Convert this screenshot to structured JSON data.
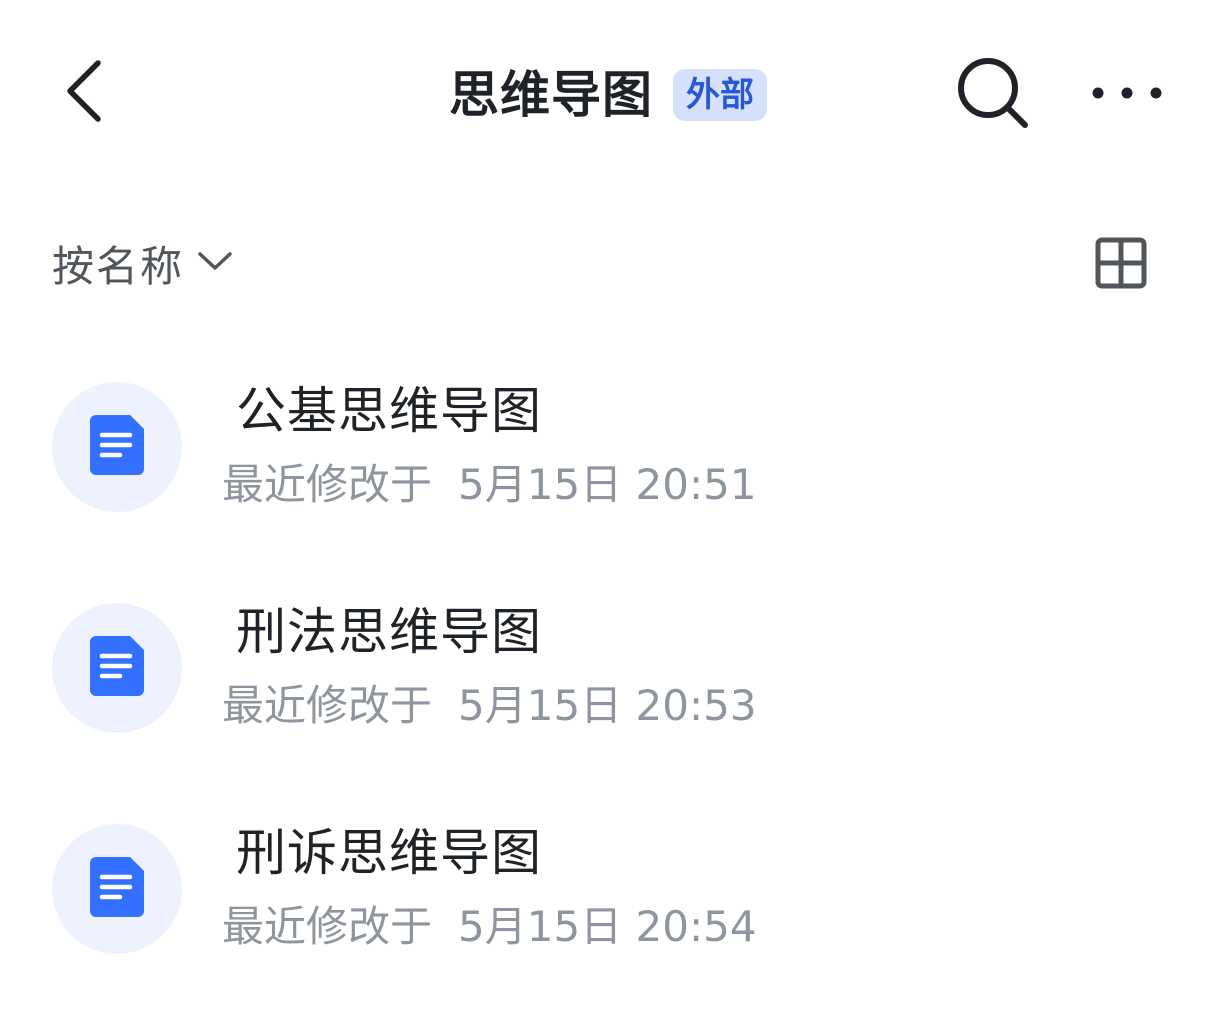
{
  "header": {
    "title": "思维导图",
    "tag": "外部",
    "back_icon": "chevron-left-icon",
    "search_icon": "search-icon",
    "more_icon": "more-horizontal-icon"
  },
  "toolbar": {
    "sort_label": "按名称",
    "sort_icon": "chevron-down-icon",
    "view_icon": "grid-view-icon"
  },
  "files": [
    {
      "name": "公基思维导图",
      "modified_prefix": "最近修改于",
      "modified_time": "5月15日 20:51",
      "icon": "document-icon"
    },
    {
      "name": "刑法思维导图",
      "modified_prefix": "最近修改于",
      "modified_time": "5月15日 20:53",
      "icon": "document-icon"
    },
    {
      "name": "刑诉思维导图",
      "modified_prefix": "最近修改于",
      "modified_time": "5月15日 20:54",
      "icon": "document-icon"
    }
  ],
  "colors": {
    "accent": "#3370ff",
    "tag_bg": "#d5e0fd",
    "tag_text": "#2858d6",
    "icon_circle_bg": "#edf2fe",
    "primary_text": "#1f2329",
    "secondary_text": "#8f959e"
  }
}
